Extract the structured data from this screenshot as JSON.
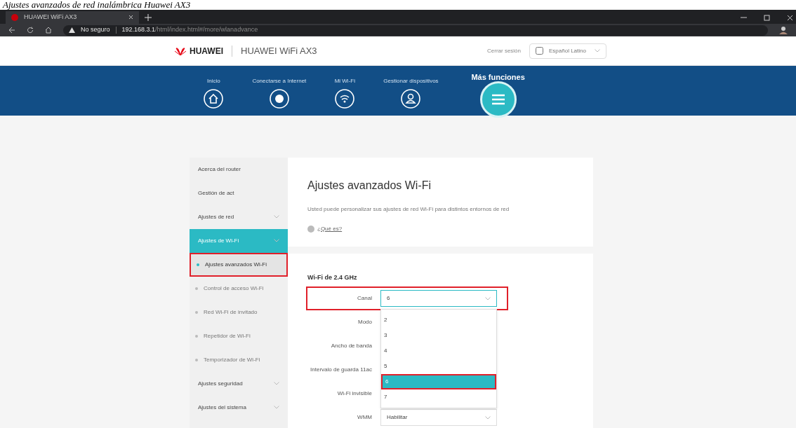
{
  "caption": "Ajustes avanzados de red inalámbrica Huawei AX3",
  "browser": {
    "tab_title": "HUAWEI WiFi AX3",
    "security": "No seguro",
    "url_host": "192.168.3.1",
    "url_path": "/html/index.html#/more/wlanadvance"
  },
  "header": {
    "brand": "HUAWEI",
    "product": "HUAWEI WiFi AX3",
    "logout": "Cerrar sesión",
    "language": "Español Latino"
  },
  "nav": [
    {
      "label": "Inicio",
      "kind": "home",
      "selected": false
    },
    {
      "label": "Conectarse a Internet",
      "kind": "globe",
      "selected": false
    },
    {
      "label": "Mi Wi-Fi",
      "kind": "wifi",
      "selected": false
    },
    {
      "label": "Gestionar dispositivos",
      "kind": "user",
      "selected": false
    },
    {
      "label": "Más funciones",
      "kind": "menu",
      "selected": true
    }
  ],
  "sidebar": [
    {
      "label": "Acerca del router",
      "selected": false,
      "expandable": false
    },
    {
      "label": "Gestión de act",
      "selected": false,
      "expandable": false
    },
    {
      "label": "Ajustes de red",
      "selected": false,
      "expandable": true
    },
    {
      "label": "Ajustes de Wi-Fi",
      "selected": true,
      "expandable": true,
      "children": [
        {
          "label": "Ajustes avanzados Wi-Fi",
          "selected": true,
          "highlighted": true
        },
        {
          "label": "Control de acceso Wi-Fi",
          "selected": false,
          "highlighted": false
        },
        {
          "label": "Red Wi-Fi de invitado",
          "selected": false,
          "highlighted": false
        },
        {
          "label": "Repetidor de Wi-Fi",
          "selected": false,
          "highlighted": false
        },
        {
          "label": "Temporizador de Wi-Fi",
          "selected": false,
          "highlighted": false
        }
      ]
    },
    {
      "label": "Ajustes seguridad",
      "selected": false,
      "expandable": true
    },
    {
      "label": "Ajustes del sistema",
      "selected": false,
      "expandable": true
    }
  ],
  "intro": {
    "title": "Ajustes avanzados Wi-Fi",
    "description": "Usted puede personalizar sus ajustes de red Wi-Fi para distintos entornos de red",
    "help_link": "¿Qué es?"
  },
  "section": {
    "title": "Wi-Fi de 2.4 GHz",
    "fields": [
      {
        "label": "Canal",
        "value": "6",
        "highlighted": true,
        "options": [
          {
            "label": "2",
            "selected": false,
            "highlighted": false
          },
          {
            "label": "3",
            "selected": false,
            "highlighted": false
          },
          {
            "label": "4",
            "selected": false,
            "highlighted": false
          },
          {
            "label": "5",
            "selected": false,
            "highlighted": false
          },
          {
            "label": "6",
            "selected": true,
            "highlighted": true
          },
          {
            "label": "7",
            "selected": false,
            "highlighted": false
          }
        ]
      },
      {
        "label": "Modo",
        "highlighted": false
      },
      {
        "label": "Ancho de banda",
        "highlighted": false
      },
      {
        "label": "Intervalo de guarda 11ac",
        "highlighted": false
      },
      {
        "label": "Wi-Fi invisible",
        "highlighted": false
      },
      {
        "label": "WMM",
        "value": "Habilitar",
        "highlighted": false
      }
    ]
  }
}
